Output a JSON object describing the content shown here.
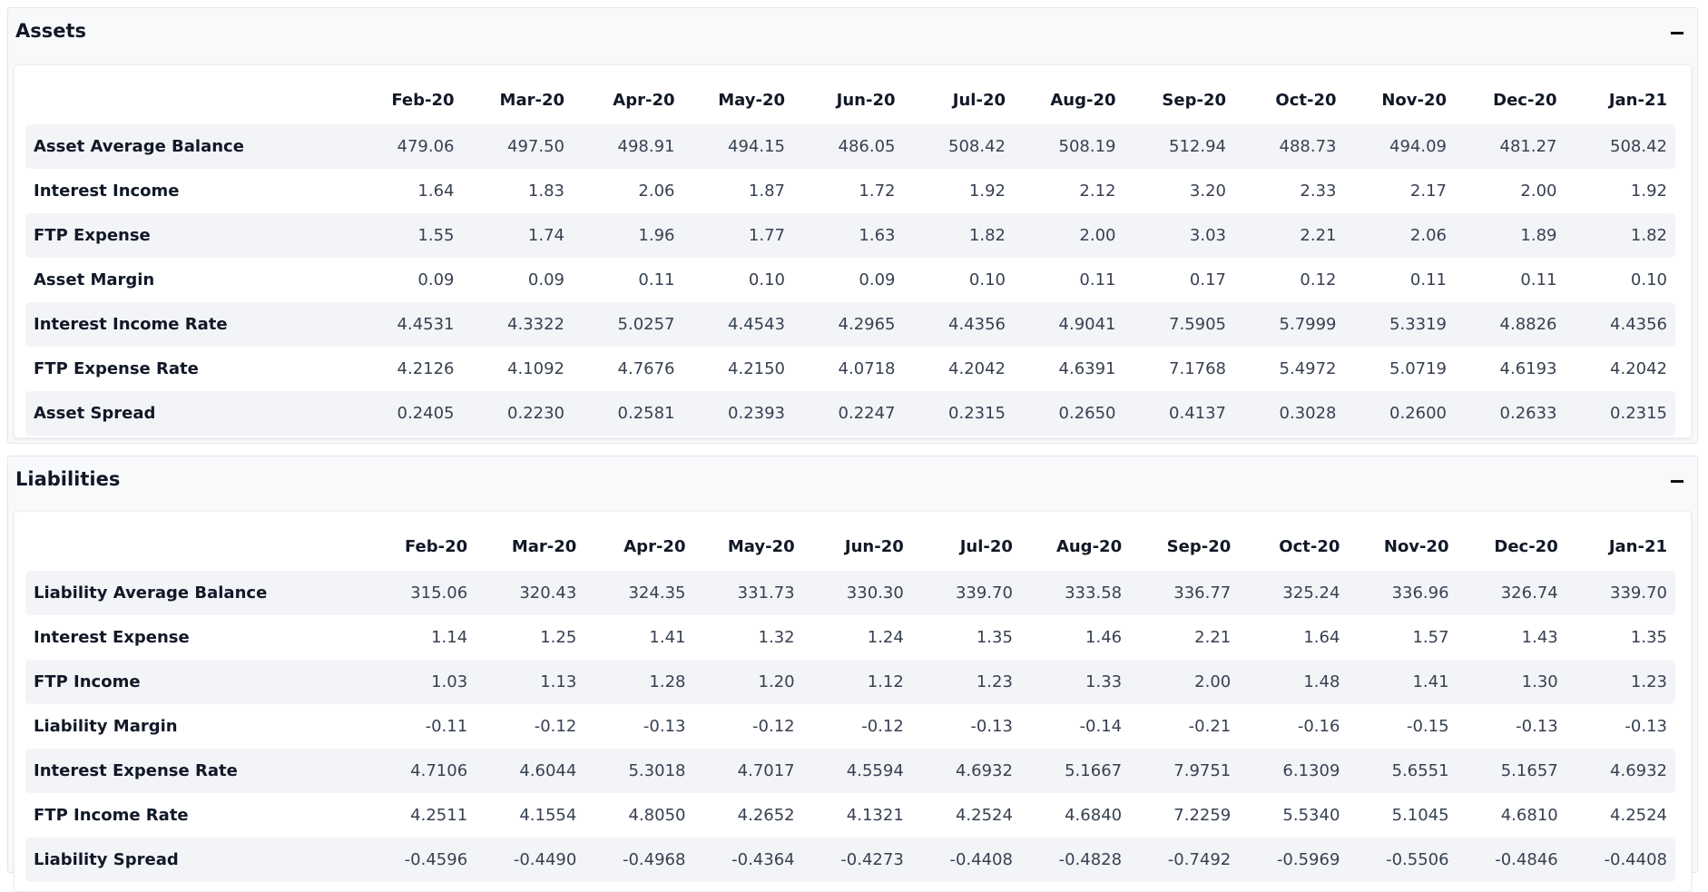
{
  "assets": {
    "title": "Assets",
    "columns": [
      "Feb-20",
      "Mar-20",
      "Apr-20",
      "May-20",
      "Jun-20",
      "Jul-20",
      "Aug-20",
      "Sep-20",
      "Oct-20",
      "Nov-20",
      "Dec-20",
      "Jan-21"
    ],
    "rows": [
      {
        "label": "Asset Average Balance",
        "values": [
          "479.06",
          "497.50",
          "498.91",
          "494.15",
          "486.05",
          "508.42",
          "508.19",
          "512.94",
          "488.73",
          "494.09",
          "481.27",
          "508.42"
        ]
      },
      {
        "label": "Interest Income",
        "values": [
          "1.64",
          "1.83",
          "2.06",
          "1.87",
          "1.72",
          "1.92",
          "2.12",
          "3.20",
          "2.33",
          "2.17",
          "2.00",
          "1.92"
        ]
      },
      {
        "label": "FTP Expense",
        "values": [
          "1.55",
          "1.74",
          "1.96",
          "1.77",
          "1.63",
          "1.82",
          "2.00",
          "3.03",
          "2.21",
          "2.06",
          "1.89",
          "1.82"
        ]
      },
      {
        "label": "Asset Margin",
        "values": [
          "0.09",
          "0.09",
          "0.11",
          "0.10",
          "0.09",
          "0.10",
          "0.11",
          "0.17",
          "0.12",
          "0.11",
          "0.11",
          "0.10"
        ]
      },
      {
        "label": "Interest Income Rate",
        "values": [
          "4.4531",
          "4.3322",
          "5.0257",
          "4.4543",
          "4.2965",
          "4.4356",
          "4.9041",
          "7.5905",
          "5.7999",
          "5.3319",
          "4.8826",
          "4.4356"
        ]
      },
      {
        "label": "FTP Expense Rate",
        "values": [
          "4.2126",
          "4.1092",
          "4.7676",
          "4.2150",
          "4.0718",
          "4.2042",
          "4.6391",
          "7.1768",
          "5.4972",
          "5.0719",
          "4.6193",
          "4.2042"
        ]
      },
      {
        "label": "Asset Spread",
        "values": [
          "0.2405",
          "0.2230",
          "0.2581",
          "0.2393",
          "0.2247",
          "0.2315",
          "0.2650",
          "0.4137",
          "0.3028",
          "0.2600",
          "0.2633",
          "0.2315"
        ]
      }
    ]
  },
  "liabilities": {
    "title": "Liabilities",
    "columns": [
      "Feb-20",
      "Mar-20",
      "Apr-20",
      "May-20",
      "Jun-20",
      "Jul-20",
      "Aug-20",
      "Sep-20",
      "Oct-20",
      "Nov-20",
      "Dec-20",
      "Jan-21"
    ],
    "rows": [
      {
        "label": "Liability Average Balance",
        "values": [
          "315.06",
          "320.43",
          "324.35",
          "331.73",
          "330.30",
          "339.70",
          "333.58",
          "336.77",
          "325.24",
          "336.96",
          "326.74",
          "339.70"
        ]
      },
      {
        "label": "Interest Expense",
        "values": [
          "1.14",
          "1.25",
          "1.41",
          "1.32",
          "1.24",
          "1.35",
          "1.46",
          "2.21",
          "1.64",
          "1.57",
          "1.43",
          "1.35"
        ]
      },
      {
        "label": "FTP Income",
        "values": [
          "1.03",
          "1.13",
          "1.28",
          "1.20",
          "1.12",
          "1.23",
          "1.33",
          "2.00",
          "1.48",
          "1.41",
          "1.30",
          "1.23"
        ]
      },
      {
        "label": "Liability Margin",
        "values": [
          "-0.11",
          "-0.12",
          "-0.13",
          "-0.12",
          "-0.12",
          "-0.13",
          "-0.14",
          "-0.21",
          "-0.16",
          "-0.15",
          "-0.13",
          "-0.13"
        ]
      },
      {
        "label": "Interest Expense Rate",
        "values": [
          "4.7106",
          "4.6044",
          "5.3018",
          "4.7017",
          "4.5594",
          "4.6932",
          "5.1667",
          "7.9751",
          "6.1309",
          "5.6551",
          "5.1657",
          "4.6932"
        ]
      },
      {
        "label": "FTP Income Rate",
        "values": [
          "4.2511",
          "4.1554",
          "4.8050",
          "4.2652",
          "4.1321",
          "4.2524",
          "4.6840",
          "7.2259",
          "5.5340",
          "5.1045",
          "4.6810",
          "4.2524"
        ]
      },
      {
        "label": "Liability Spread",
        "values": [
          "-0.4596",
          "-0.4490",
          "-0.4968",
          "-0.4364",
          "-0.4273",
          "-0.4408",
          "-0.4828",
          "-0.7492",
          "-0.5969",
          "-0.5506",
          "-0.4846",
          "-0.4408"
        ]
      }
    ]
  },
  "icons": {
    "collapse": "minus-icon"
  }
}
